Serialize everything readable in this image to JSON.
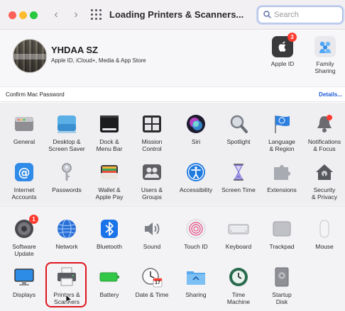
{
  "window": {
    "title": "Loading Printers & Scanners...",
    "search_placeholder": "Search"
  },
  "account": {
    "name": "YHDAA SZ",
    "subtitle": "Apple ID, iCloud+, Media & App Store",
    "apple_id_label": "Apple ID",
    "apple_id_badge": "3",
    "family_label_1": "Family",
    "family_label_2": "Sharing"
  },
  "confirm_bar": {
    "text": "Confirm Mac Password",
    "link": "Details..."
  },
  "panes_row1": [
    {
      "l1": "General",
      "l2": ""
    },
    {
      "l1": "Desktop &",
      "l2": "Screen Saver"
    },
    {
      "l1": "Dock &",
      "l2": "Menu Bar"
    },
    {
      "l1": "Mission",
      "l2": "Control"
    },
    {
      "l1": "Siri",
      "l2": ""
    },
    {
      "l1": "Spotlight",
      "l2": ""
    },
    {
      "l1": "Language",
      "l2": "& Region"
    },
    {
      "l1": "Notifications",
      "l2": "& Focus"
    }
  ],
  "panes_row2": [
    {
      "l1": "Internet",
      "l2": "Accounts"
    },
    {
      "l1": "Passwords",
      "l2": ""
    },
    {
      "l1": "Wallet &",
      "l2": "Apple Pay"
    },
    {
      "l1": "Users &",
      "l2": "Groups"
    },
    {
      "l1": "Accessibility",
      "l2": ""
    },
    {
      "l1": "Screen Time",
      "l2": ""
    },
    {
      "l1": "Extensions",
      "l2": ""
    },
    {
      "l1": "Security",
      "l2": "& Privacy"
    }
  ],
  "panes_row3": [
    {
      "l1": "Software",
      "l2": "Update"
    },
    {
      "l1": "Network",
      "l2": ""
    },
    {
      "l1": "Bluetooth",
      "l2": ""
    },
    {
      "l1": "Sound",
      "l2": ""
    },
    {
      "l1": "Touch ID",
      "l2": ""
    },
    {
      "l1": "Keyboard",
      "l2": ""
    },
    {
      "l1": "Trackpad",
      "l2": ""
    },
    {
      "l1": "Mouse",
      "l2": ""
    }
  ],
  "panes_row4": [
    {
      "l1": "Displays",
      "l2": ""
    },
    {
      "l1": "Printers &",
      "l2": "Scanners"
    },
    {
      "l1": "Battery",
      "l2": ""
    },
    {
      "l1": "Date & Time",
      "l2": ""
    },
    {
      "l1": "Sharing",
      "l2": ""
    },
    {
      "l1": "Time",
      "l2": "Machine"
    },
    {
      "l1": "Startup",
      "l2": "Disk"
    }
  ],
  "software_update_badge": "1",
  "date_time_day": "17",
  "colors": {
    "highlight": "#e0141e",
    "link": "#1d5ad8",
    "badge": "#ff3b30"
  }
}
